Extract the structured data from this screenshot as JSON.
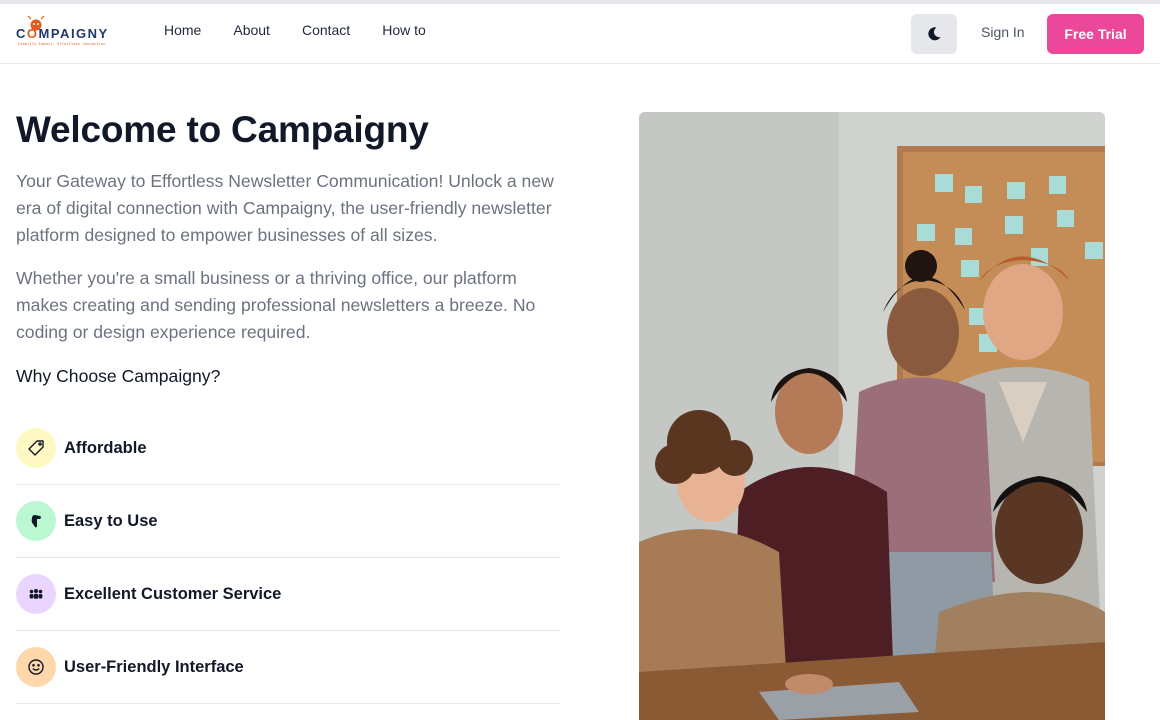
{
  "brand": {
    "name_first": "C",
    "name_accent": "O",
    "name_rest": "MPAIGNY",
    "tagline": "Simplify Impact. Effortless Connection"
  },
  "nav": {
    "links": [
      "Home",
      "About",
      "Contact",
      "How to"
    ],
    "sign_in": "Sign In",
    "free_trial": "Free Trial"
  },
  "hero": {
    "title": "Welcome to Campaigny",
    "paragraph_1": "Your Gateway to Effortless Newsletter Communication! Unlock a new era of digital connection with Campaigny, the user-friendly newsletter platform designed to empower businesses of all sizes.",
    "paragraph_2": "Whether you're a small business or a thriving office, our platform makes creating and sending professional newsletters a breeze. No coding or design experience required.",
    "why_heading": "Why Choose Campaigny?"
  },
  "features": [
    {
      "label": "Affordable",
      "icon": "price-tag-icon",
      "bg": "#fef9c3"
    },
    {
      "label": "Easy to Use",
      "icon": "pointer-hand-icon",
      "bg": "#bbf7d0"
    },
    {
      "label": "Excellent Customer Service",
      "icon": "people-group-icon",
      "bg": "#e9d5ff"
    },
    {
      "label": "User-Friendly Interface",
      "icon": "smiley-face-icon",
      "bg": "#fed7aa"
    }
  ],
  "colors": {
    "accent": "#ec4899",
    "brand_orange": "#e55a1c",
    "brand_navy": "#1f3a68",
    "muted_text": "#6b7280"
  }
}
